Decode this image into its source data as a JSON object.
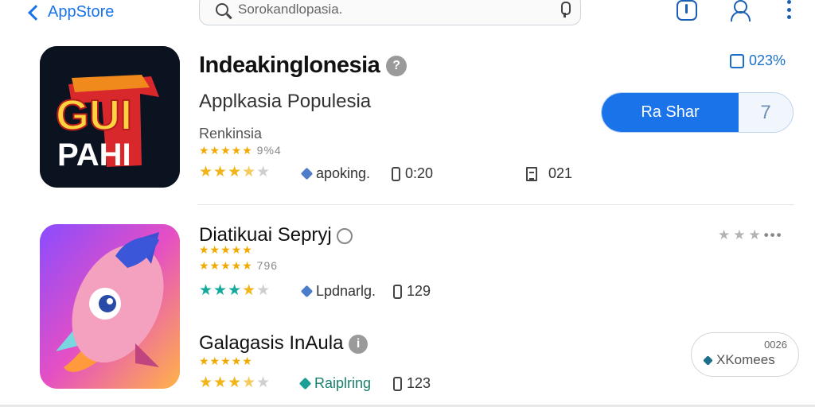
{
  "header": {
    "back_label": "AppStore",
    "search_placeholder": "Sorokandlopasia."
  },
  "apps": [
    {
      "icon_text_top": "GUI",
      "icon_text_bottom": "PAHI",
      "title": "Indeakinglonesia",
      "subtitle": "Applkasia Populesia",
      "developer": "Renkinsia",
      "minor_rating": "9%4",
      "rating_stars": 3.5,
      "category": "apoking.",
      "size": "0:20",
      "doc_value": "021",
      "percent_label": "023%",
      "get_button_label": "Ra Shar",
      "get_button_side": "7"
    },
    {
      "title": "Diatikuai Sepryj",
      "minor_rating": "796",
      "rating_stars": 4,
      "category": "Lpdnarlg.",
      "size": "129"
    },
    {
      "title": "Galagasis InAula",
      "rating_stars": 3.5,
      "category": "Raiplring",
      "size": "123",
      "pill_number": "0026",
      "pill_label": "XKomees"
    }
  ],
  "colors": {
    "accent": "#1a73e8",
    "star": "#f2b418",
    "star_teal": "#14a99a"
  }
}
